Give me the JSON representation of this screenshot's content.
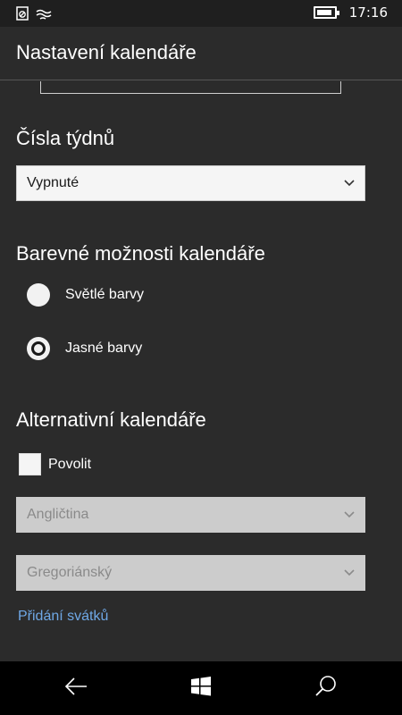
{
  "status_bar": {
    "time": "17:16",
    "battery_level": 0.9,
    "icons": [
      "sync-blocked-icon",
      "wifi-icon",
      "battery-icon"
    ]
  },
  "header": {
    "title": "Nastavení kalendáře"
  },
  "week_numbers": {
    "heading": "Čísla týdnů",
    "selected": "Vypnuté"
  },
  "color_options": {
    "heading": "Barevné možnosti kalendáře",
    "options": [
      {
        "label": "Světlé barvy",
        "checked": false
      },
      {
        "label": "Jasné barvy",
        "checked": true
      }
    ]
  },
  "alt_calendars": {
    "heading": "Alternativní kalendáře",
    "enable_label": "Povolit",
    "enabled": false,
    "language_selected": "Angličtina",
    "calendar_selected": "Gregoriánský",
    "add_holidays_link": "Přidání svátků"
  },
  "colors": {
    "background": "#2b2b2b",
    "link": "#6fa8e6",
    "disabled_select": "#cccccc"
  }
}
